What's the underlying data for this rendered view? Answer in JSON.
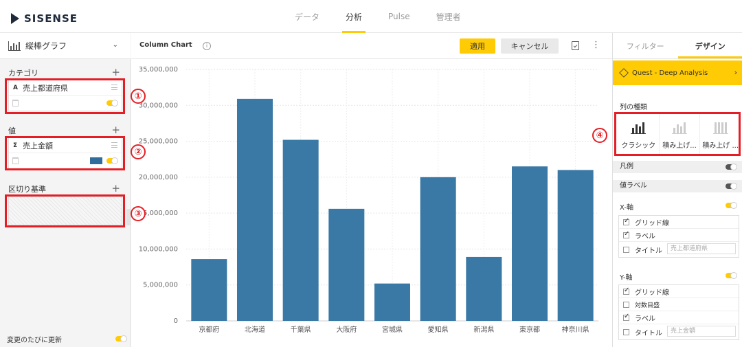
{
  "app": {
    "logo_text": "SISENSE",
    "nav_tabs": [
      {
        "label": "データ",
        "active": false
      },
      {
        "label": "分析",
        "active": true
      },
      {
        "label": "Pulse",
        "active": false
      },
      {
        "label": "管理者",
        "active": false
      }
    ]
  },
  "left": {
    "chart_type": "縦棒グラフ",
    "category": {
      "header": "カテゴリ",
      "field_type": "A",
      "field": "売上都道府県"
    },
    "value": {
      "header": "値",
      "field_type": "Σ",
      "field": "売上金額"
    },
    "break_by": {
      "header": "区切り基準"
    },
    "auto_update_label": "変更のたびに更新"
  },
  "callouts": [
    "①",
    "②",
    "③",
    "④"
  ],
  "toolbar": {
    "title": "Column Chart",
    "info_glyph": "i",
    "apply": "適用",
    "cancel": "キャンセル",
    "more_glyph": "⋮"
  },
  "right": {
    "tabs": [
      {
        "label": "フィルター",
        "active": false
      },
      {
        "label": "デザイン",
        "active": true
      }
    ],
    "banner": "Quest - Deep Analysis",
    "banner_chev": "›",
    "column_types_label": "列の種類",
    "column_types": [
      {
        "label": "クラシック",
        "selected": true
      },
      {
        "label": "積み上げ...",
        "selected": false
      },
      {
        "label": "積み上げ ...",
        "selected": false
      }
    ],
    "legend": "凡例",
    "value_labels": "値ラベル",
    "x_axis": {
      "header": "X-軸",
      "options": [
        {
          "label": "グリッド線",
          "checked": true
        },
        {
          "label": "ラベル",
          "checked": true
        },
        {
          "label": "タイトル",
          "checked": false,
          "placeholder": "売上都道府県"
        }
      ]
    },
    "y_axis": {
      "header": "Y-軸",
      "options": [
        {
          "label": "グリッド線",
          "checked": true
        },
        {
          "label": "対数目盛",
          "checked": false
        },
        {
          "label": "ラベル",
          "checked": true
        },
        {
          "label": "タイトル",
          "checked": false,
          "placeholder": "売上金額"
        }
      ]
    }
  },
  "colors": {
    "bar": "#3a78a5",
    "accent": "#ffcb05",
    "annotation": "#e51e25"
  },
  "chart_data": {
    "type": "bar",
    "categories": [
      "京都府",
      "北海道",
      "千葉県",
      "大阪府",
      "宮城県",
      "愛知県",
      "新潟県",
      "東京都",
      "神奈川県"
    ],
    "values": [
      8600000,
      30900000,
      25200000,
      15600000,
      5200000,
      20000000,
      8900000,
      21500000,
      21000000
    ],
    "ylim": [
      0,
      35000000
    ],
    "yticks": [
      0,
      5000000,
      10000000,
      15000000,
      20000000,
      25000000,
      30000000,
      35000000
    ],
    "ytick_labels": [
      "0",
      "5,000,000",
      "10,000,000",
      "15,000,000",
      "20,000,000",
      "25,000,000",
      "30,000,000",
      "35,000,000"
    ],
    "grid": true
  }
}
